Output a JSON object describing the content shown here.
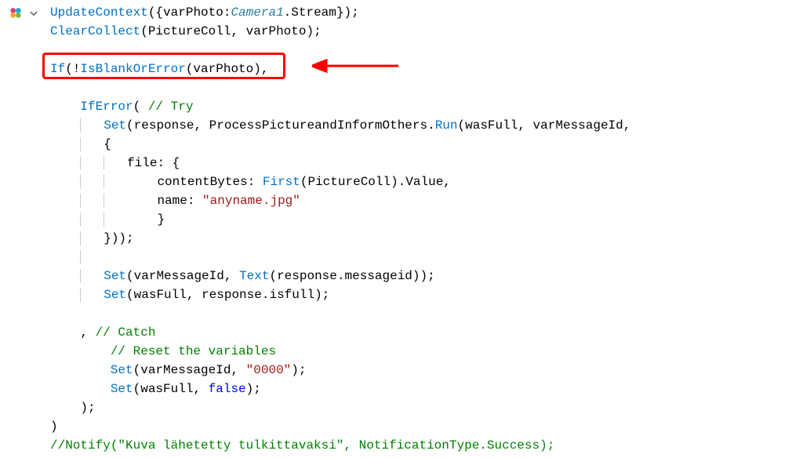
{
  "highlight": {
    "has_arrow": true
  },
  "code": {
    "line1": {
      "fn1": "UpdateContext",
      "open": "({",
      "prop": "varPhoto",
      "colon": ":",
      "italic": "Camera1",
      "dot": ".Stream});"
    },
    "line2": {
      "fn1": "ClearCollect",
      "open": "(",
      "arg1": "PictureColl",
      "comma": ", varPhoto);"
    },
    "line4": {
      "fn1": "If",
      "open": "(!",
      "fn2": "IsBlankOrError",
      "open2": "(varPhoto),"
    },
    "line6": {
      "fn1": "IfError",
      "open": "( ",
      "comment": "// Try"
    },
    "line7": {
      "fn1": "Set",
      "open": "(response, ProcessPictureandInformOthers.",
      "fn2": "Run",
      "open2": "(wasFull, varMessageId,"
    },
    "line8": {
      "text": "{"
    },
    "line9": {
      "prop": "file",
      "colon": ": {"
    },
    "line10": {
      "prop": "contentBytes",
      "colon": ": ",
      "fn1": "First",
      "open": "(PictureColl).Value,"
    },
    "line11": {
      "prop": "name",
      "colon": ": ",
      "string": "\"anyname.jpg\""
    },
    "line12": {
      "text": "}"
    },
    "line13": {
      "text": "}));"
    },
    "line15": {
      "fn1": "Set",
      "open": "(varMessageId, ",
      "fn2": "Text",
      "open2": "(response.messageid));"
    },
    "line16": {
      "fn1": "Set",
      "open": "(wasFull, response.isfull);"
    },
    "line18": {
      "comma": ", ",
      "comment": "// Catch"
    },
    "line19": {
      "comment": "// Reset the variables"
    },
    "line20": {
      "fn1": "Set",
      "open": "(varMessageId, ",
      "string": "\"0000\"",
      "close": ");"
    },
    "line21": {
      "fn1": "Set",
      "open": "(wasFull, ",
      "keyword": "false",
      "close": ");"
    },
    "line22": {
      "text": ");"
    },
    "line23": {
      "text": ")"
    },
    "line24": {
      "comment": "//Notify(\"Kuva lähetetty tulkittavaksi\", NotificationType.Success);"
    }
  }
}
